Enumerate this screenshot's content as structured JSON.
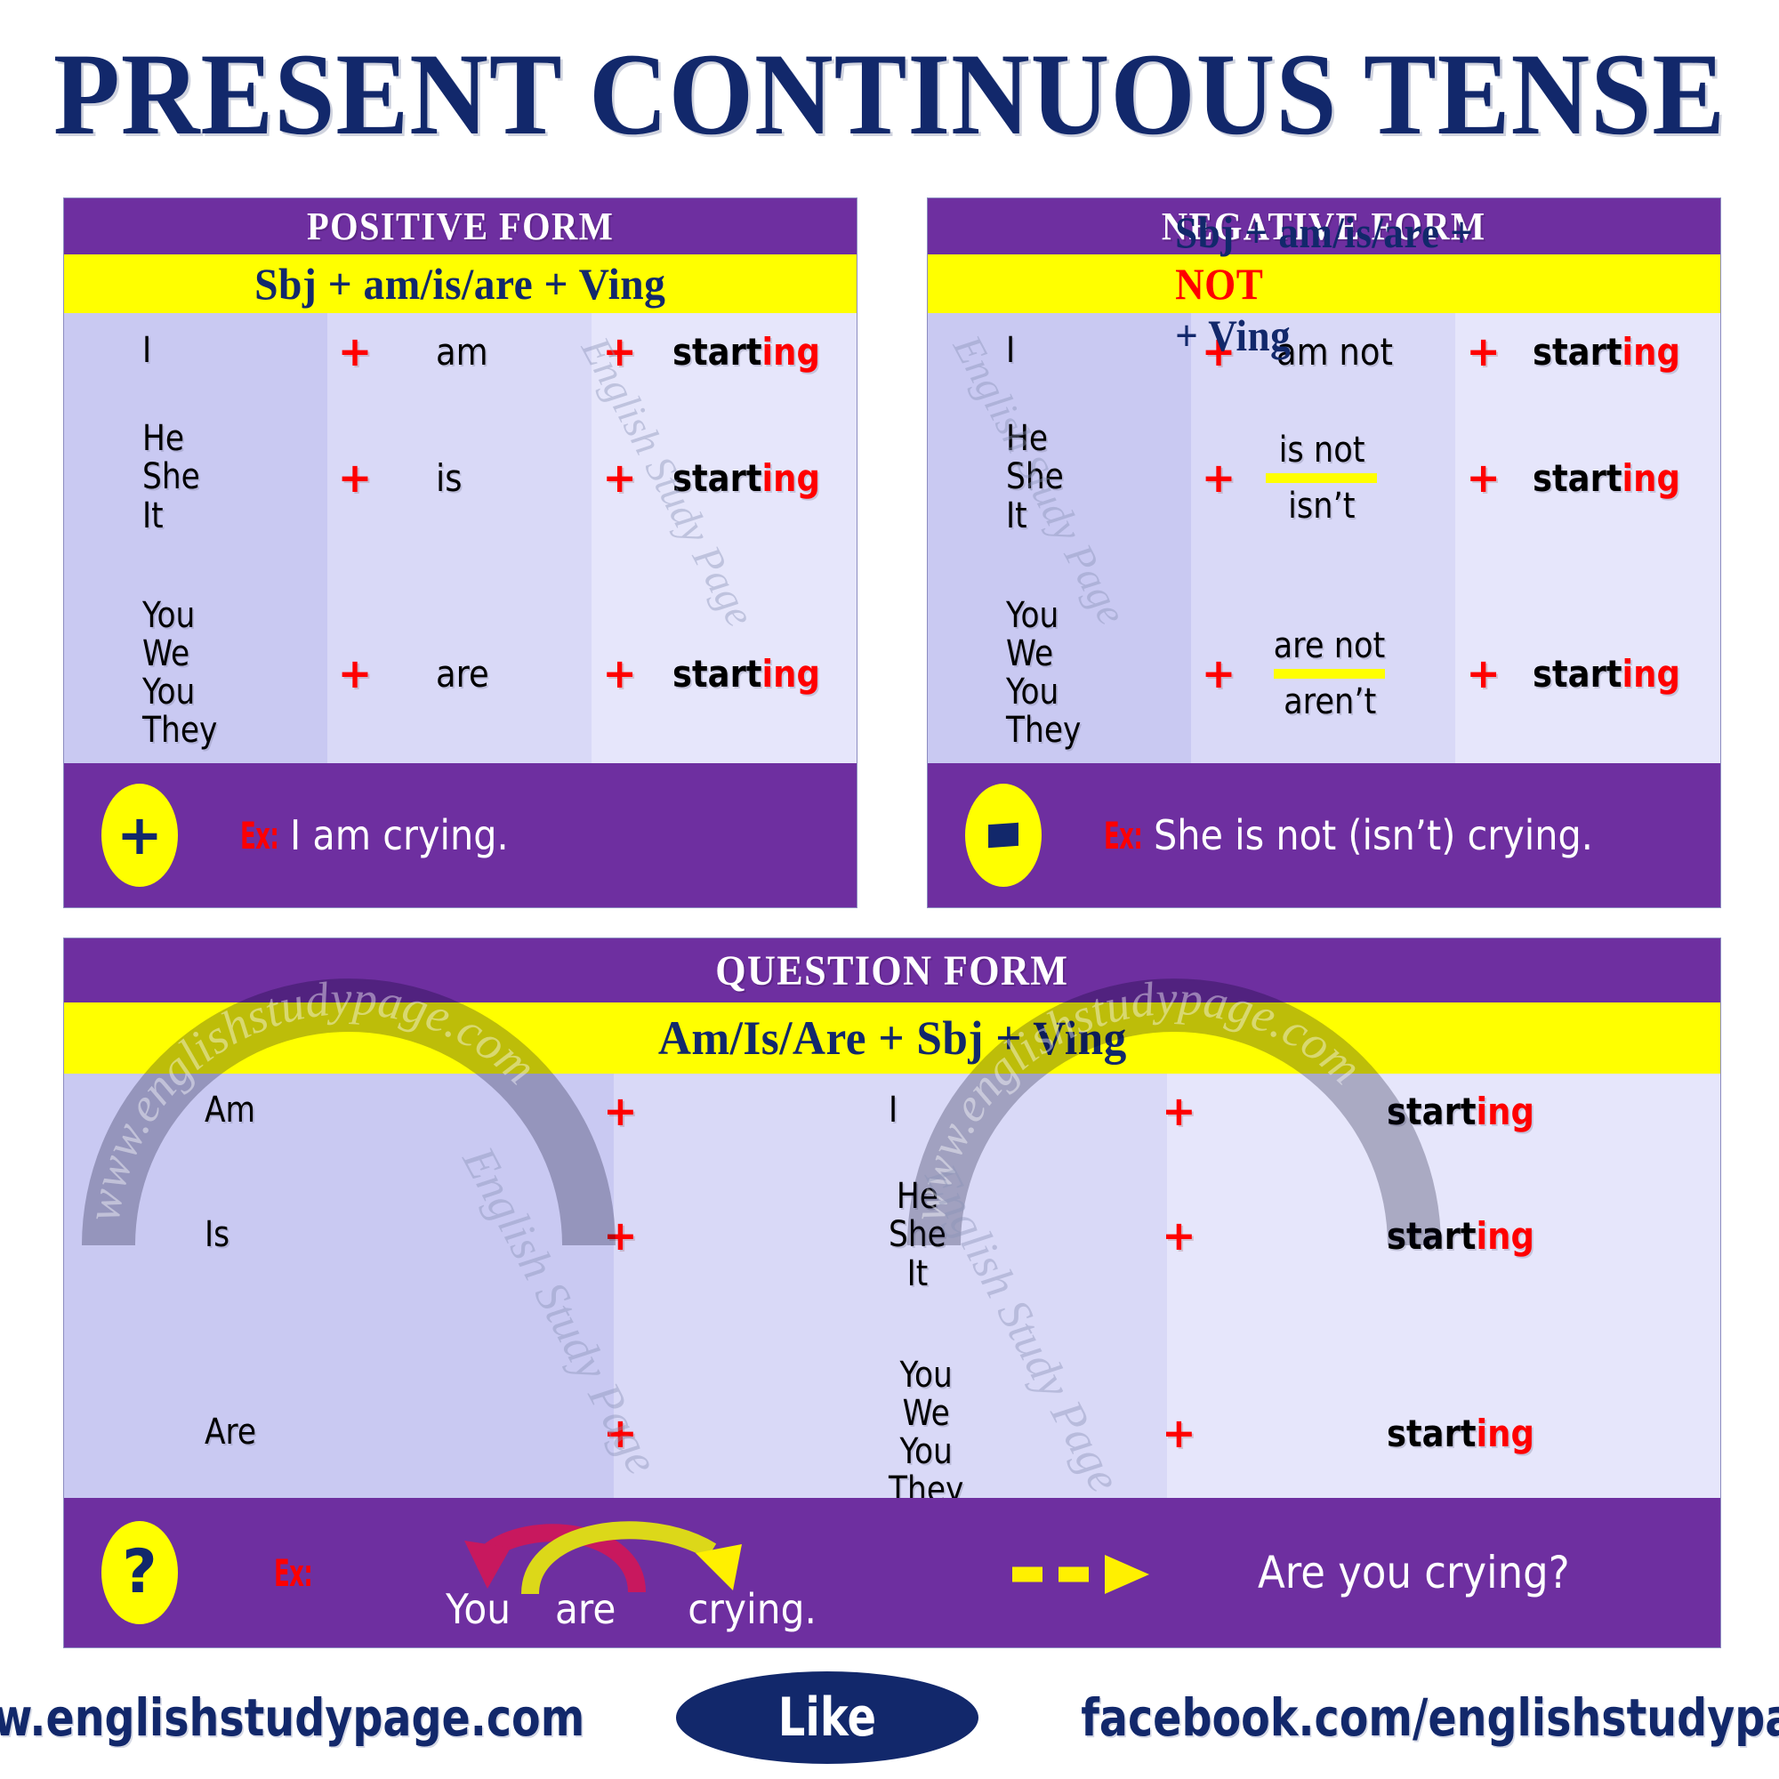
{
  "title": "PRESENT CONTINUOUS TENSE",
  "colors": {
    "purple": "#6E2FA0",
    "yellow": "#FFFF00",
    "navy": "#12286B",
    "red": "#FF0000",
    "lavender_dark": "#C9C9F2",
    "lavender_mid": "#D9D9F7",
    "lavender_light": "#E6E6FB",
    "crimson_arrow": "#C8185E",
    "yellow_arrow": "#FFF000"
  },
  "positive": {
    "header": "POSITIVE FORM",
    "formula": "Sbj + am/is/are + Ving",
    "rows": [
      {
        "subject": "I",
        "plus1": "+",
        "verb": "am",
        "plus2": "+",
        "ving_stem": "start",
        "ving_suffix": "ing"
      },
      {
        "subject": "He\nShe\nIt",
        "plus1": "+",
        "verb": "is",
        "plus2": "+",
        "ving_stem": "start",
        "ving_suffix": "ing"
      },
      {
        "subject": "You\nWe\nYou\nThey",
        "plus1": "+",
        "verb": "are",
        "plus2": "+",
        "ving_stem": "start",
        "ving_suffix": "ing"
      }
    ],
    "footer": {
      "badge": "plus-badge",
      "badge_glyph": "+",
      "ex_label": "Ex:",
      "example": "I am crying."
    }
  },
  "negative": {
    "header": "NEGATIVE FORM",
    "formula_part1": "Sbj + am/is/are + ",
    "formula_not": "NOT",
    "formula_part2": " + Ving",
    "rows": [
      {
        "subject": "I",
        "plus1": "+",
        "verb_long": "am not",
        "verb_short": "",
        "plus2": "+",
        "ving_stem": "start",
        "ving_suffix": "ing"
      },
      {
        "subject": "He\nShe\nIt",
        "plus1": "+",
        "verb_long": "is not",
        "verb_short": "isn’t",
        "plus2": "+",
        "ving_stem": "start",
        "ving_suffix": "ing"
      },
      {
        "subject": "You\nWe\nYou\nThey",
        "plus1": "+",
        "verb_long": "are not",
        "verb_short": "aren’t",
        "plus2": "+",
        "ving_stem": "start",
        "ving_suffix": "ing"
      }
    ],
    "footer": {
      "badge": "minus-badge",
      "badge_glyph": "-",
      "ex_label": "Ex:",
      "example": "She is not (isn’t) crying."
    }
  },
  "question": {
    "header": "QUESTION FORM",
    "formula": "Am/Is/Are +  Sbj + Ving",
    "rows": [
      {
        "aux": "Am",
        "plus1": "+",
        "subject": "I",
        "plus2": "+",
        "ving_stem": "start",
        "ving_suffix": "ing"
      },
      {
        "aux": "Is",
        "plus1": "+",
        "subject": "He\nShe\nIt",
        "plus2": "+",
        "ving_stem": "start",
        "ving_suffix": "ing"
      },
      {
        "aux": "Are",
        "plus1": "+",
        "subject": "You\nWe\nYou\nThey",
        "plus2": "+",
        "ving_stem": "start",
        "ving_suffix": "ing"
      }
    ],
    "footer": {
      "badge": "question-badge",
      "badge_glyph": "?",
      "ex_label": "Ex:",
      "source_words": [
        "You",
        "are",
        "crying."
      ],
      "result": "Are you crying?"
    }
  },
  "watermarks": {
    "arch_text": "www.englishstudypage.com",
    "diagonal_text": "English Study Page"
  },
  "bottom": {
    "website": "www.englishstudypage.com",
    "like": "Like",
    "facebook": "facebook.com/englishstudypage"
  }
}
